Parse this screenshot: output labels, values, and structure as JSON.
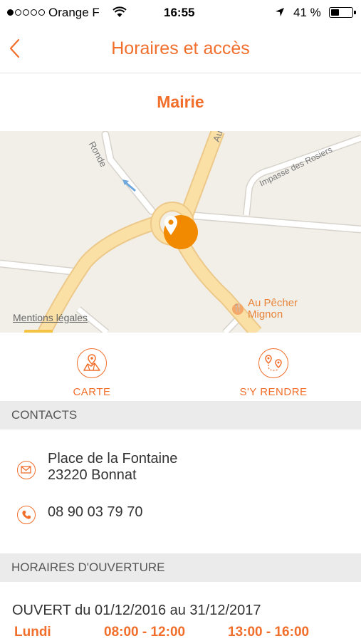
{
  "status_bar": {
    "carrier": "Orange F",
    "time": "16:55",
    "battery_percent": "41 %",
    "battery_level": 0.41
  },
  "nav": {
    "title": "Horaires et accès"
  },
  "place": {
    "name": "Mairie"
  },
  "map": {
    "labels": {
      "road_ronde": "Ronde",
      "road_impasse": "Impasse des Rosiers",
      "road_au": "Au"
    },
    "poi": {
      "name_line1": "Au Pêcher",
      "name_line2": "Mignon"
    },
    "legal_link": "Mentions légales"
  },
  "actions": {
    "carte": "CARTE",
    "rendre": "S'Y RENDRE"
  },
  "contacts": {
    "header": "CONTACTS",
    "address_line1": "Place de la Fontaine",
    "address_line2": "23220 Bonnat",
    "phone": "08 90 03 79 70"
  },
  "hours": {
    "header": "HORAIRES D'OUVERTURE",
    "period": "OUVERT du 01/12/2016 au 31/12/2017",
    "rows": [
      {
        "day": "Lundi",
        "morning": "08:00 - 12:00",
        "afternoon": "13:00 - 16:00"
      }
    ]
  },
  "colors": {
    "accent": "#f16e2b",
    "marker": "#f18a00",
    "road": "#fbe0a5",
    "map_bg": "#f2efe9"
  },
  "icons": {
    "back": "chevron-left-icon",
    "map_action": "map-icon",
    "route_action": "directions-icon",
    "email": "mail-icon",
    "phone": "phone-icon",
    "marker": "location-pin-icon"
  }
}
